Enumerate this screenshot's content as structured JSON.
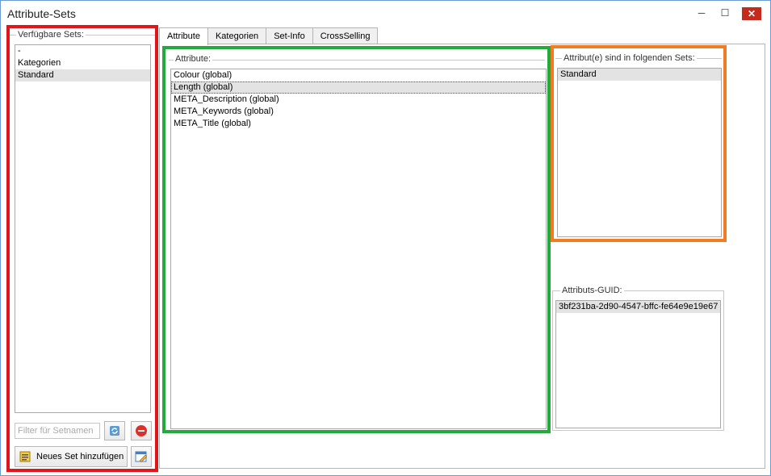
{
  "window": {
    "title": "Attribute-Sets",
    "minimize_glyph": "─",
    "maximize_glyph": "☐",
    "close_glyph": "✕"
  },
  "left": {
    "group_label": "Verfügbare Sets:",
    "sets": [
      "-",
      "Kategorien",
      "Standard"
    ],
    "selected_index": 2,
    "filter_placeholder": "Filter für Setnamen",
    "add_button_label": "Neues Set hinzufügen",
    "icons": [
      "refresh-icon",
      "delete-icon",
      "list-add-icon",
      "edit-icon"
    ]
  },
  "tabs": [
    "Attribute",
    "Kategorien",
    "Set-Info",
    "CrossSelling"
  ],
  "active_tab": 0,
  "attributes": {
    "group_label": "Attribute:",
    "items": [
      "Colour (global)",
      "Length (global)",
      "META_Description (global)",
      "META_Keywords (global)",
      "META_Title (global)"
    ],
    "selected_index": 1
  },
  "assigned_sets": {
    "group_label": "Attribut(e) sind in folgenden Sets:",
    "items": [
      "Standard"
    ]
  },
  "guid": {
    "group_label": "Attributs-GUID:",
    "value": "3bf231ba-2d90-4547-bffc-fe64e9e19e67"
  },
  "colors": {
    "left_highlight": "#e2151b",
    "attr_highlight": "#22aa3a",
    "sets_highlight": "#f07d25"
  }
}
